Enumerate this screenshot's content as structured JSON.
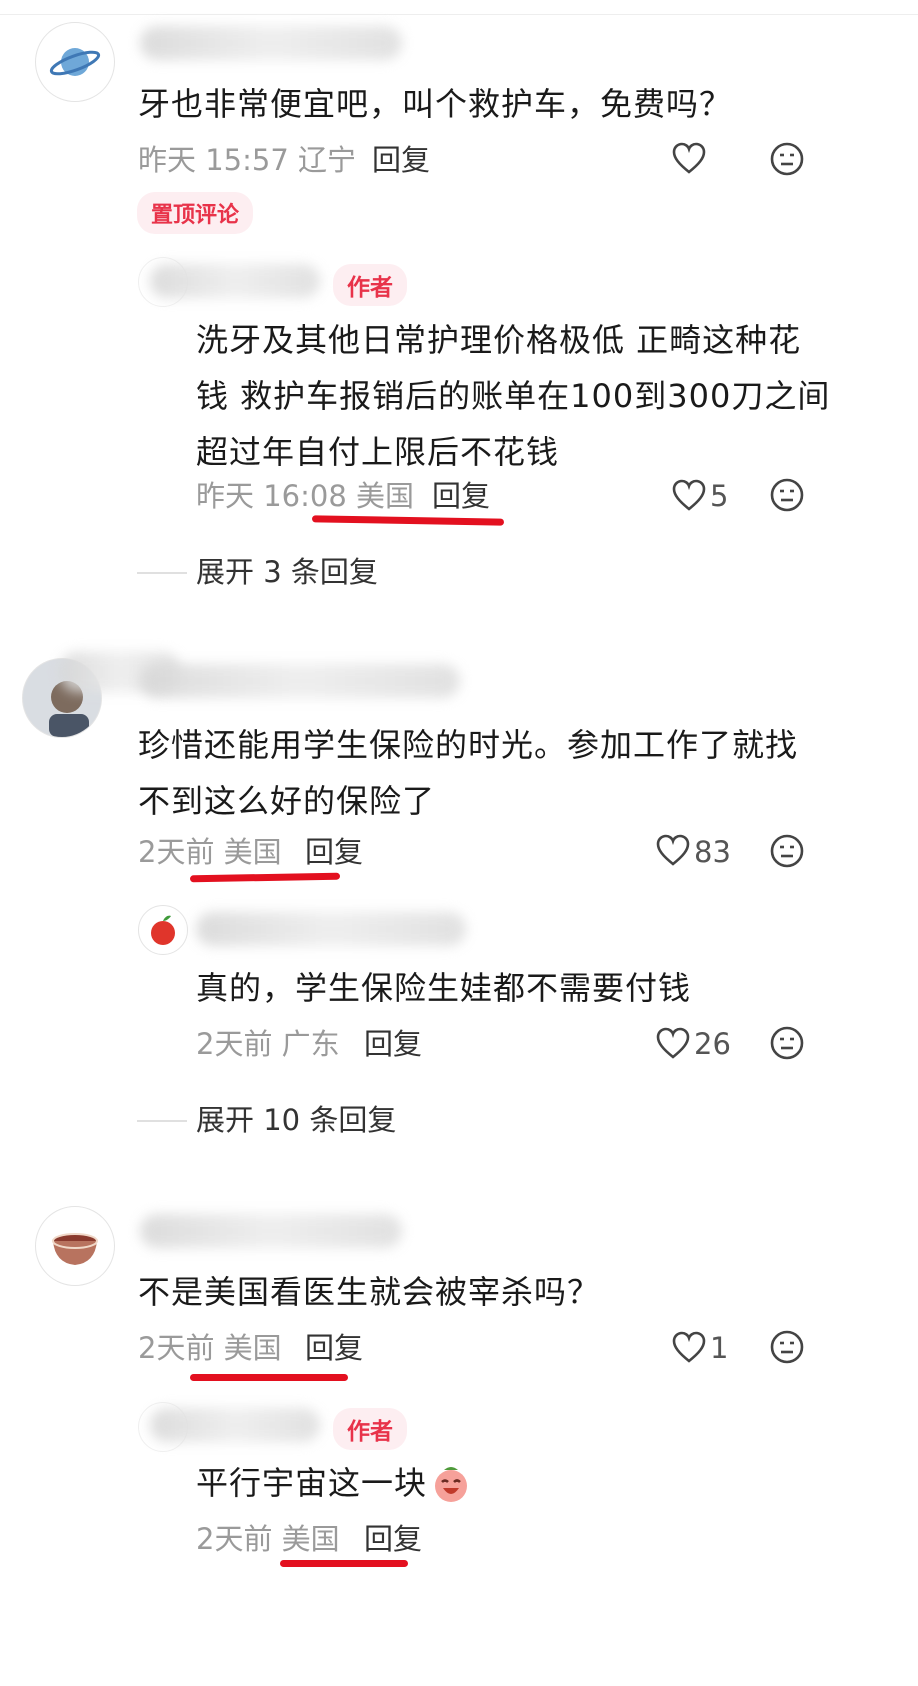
{
  "comments": [
    {
      "text": "牙也非常便宜吧，叫个救护车，免费吗？",
      "time": "昨天 15:57",
      "location": "辽宁",
      "reply": "回复",
      "pin_tag": "置顶评论",
      "replies": [
        {
          "author_tag": "作者",
          "text_lines": [
            "洗牙及其他日常护理价格极低 正畸这种花",
            "钱 救护车报销后的账单在100到300刀之间",
            "超过年自付上限后不花钱"
          ],
          "time": "昨天 16:08",
          "location": "美国",
          "reply": "回复",
          "likes": "5"
        }
      ],
      "expand": "展开 3 条回复"
    },
    {
      "text_lines": [
        "珍惜还能用学生保险的时光。参加工作了就找",
        "不到这么好的保险了"
      ],
      "time": "2天前",
      "location": "美国",
      "reply": "回复",
      "likes": "83",
      "replies": [
        {
          "text": "真的，学生保险生娃都不需要付钱",
          "time": "2天前",
          "location": "广东",
          "reply": "回复",
          "likes": "26"
        }
      ],
      "expand": "展开 10 条回复"
    },
    {
      "text": "不是美国看医生就会被宰杀吗？",
      "time": "2天前",
      "location": "美国",
      "reply": "回复",
      "likes": "1",
      "replies": [
        {
          "author_tag": "作者",
          "text": "平行宇宙这一块",
          "time": "2天前",
          "location": "美国",
          "reply": "回复"
        }
      ]
    }
  ],
  "icons": {
    "like": "heart-outline-icon",
    "emoji": "emoji-face-icon"
  },
  "colors": {
    "accent": "#e8334a",
    "annotation": "#e3101f"
  }
}
